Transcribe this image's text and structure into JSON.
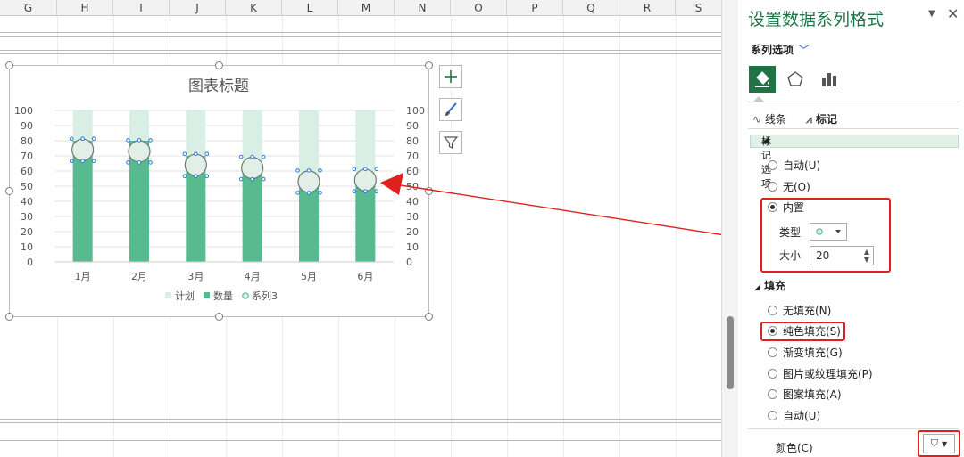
{
  "sheet": {
    "columns": [
      "G",
      "H",
      "I",
      "J",
      "K",
      "L",
      "M",
      "N",
      "O",
      "P",
      "Q",
      "R",
      "S"
    ]
  },
  "chart_data": {
    "type": "bar",
    "title": "图表标题",
    "categories": [
      "1月",
      "2月",
      "3月",
      "4月",
      "5月",
      "6月"
    ],
    "series": [
      {
        "name": "计划",
        "type": "bar",
        "values": [
          100,
          100,
          100,
          100,
          100,
          100
        ],
        "color": "#d9efe6"
      },
      {
        "name": "数量",
        "type": "bar",
        "values": [
          80,
          80,
          70,
          65,
          55,
          55
        ],
        "color": "#57bb8f"
      },
      {
        "name": "系列3",
        "type": "scatter",
        "values": [
          74,
          73,
          64,
          62,
          53,
          54
        ],
        "color": "#e2efe9"
      }
    ],
    "ylim": [
      0,
      100
    ],
    "yticks": [
      0,
      10,
      20,
      30,
      40,
      50,
      60,
      70,
      80,
      90,
      100
    ],
    "secondary_ylim": [
      0,
      100
    ],
    "grid": true,
    "legend": "bottom"
  },
  "chart_buttons": {
    "add_icon": "plus-icon",
    "style_icon": "brush-icon",
    "filter_icon": "filter-icon"
  },
  "pane": {
    "title": "设置数据系列格式",
    "series_options": "系列选项",
    "tabs": [
      {
        "name": "fill-line",
        "icon": "paint-bucket-icon"
      },
      {
        "name": "effects",
        "icon": "pentagon-icon"
      },
      {
        "name": "series-options",
        "icon": "bar-chart-icon"
      }
    ],
    "subtab_line": "线条",
    "subtab_marker": "标记",
    "marker_section": "标记选项",
    "marker_options": {
      "auto": "自动(U)",
      "none": "无(O)",
      "builtin": "内置",
      "type_label": "类型",
      "size_label": "大小",
      "size_value": "20"
    },
    "fill_section": "填充",
    "fill_options": {
      "no_fill": "无填充(N)",
      "solid": "纯色填充(S)",
      "gradient": "渐变填充(G)",
      "picture": "图片或纹理填充(P)",
      "pattern": "图案填充(A)",
      "auto": "自动(U)"
    },
    "color_label": "颜色(C)",
    "accent_color": "#217346",
    "highlight_color": "#e0201c"
  }
}
